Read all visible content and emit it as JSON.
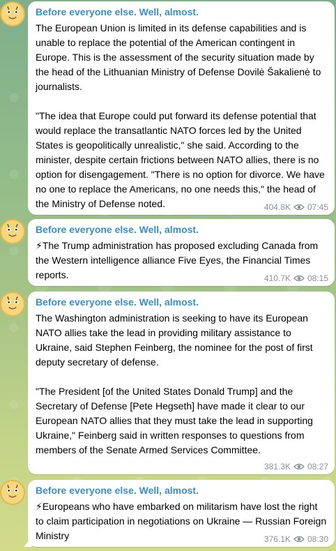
{
  "channel": {
    "sender_name": "Before everyone else. Well, almost."
  },
  "messages": [
    {
      "text": "The European Union is limited in its defense capabilities and is unable to replace the potential of the American contingent in Europe. This is the assessment of the security situation made by the head of the Lithuanian Ministry of Defense Dovilė Šakalienė to journalists.\n\n\"The idea that Europe could put forward its defense potential that would replace the transatlantic NATO forces led by the United States is geopolitically unrealistic,\" she said. According to the minister, despite certain frictions between NATO allies, there is no option for disengagement. \"There is no option for divorce. We have no one to replace the Americans, no one needs this,\" the head of the Ministry of Defense noted.",
      "views": "404.8K",
      "time": "07:45"
    },
    {
      "text": "⚡The Trump administration has proposed excluding Canada from the Western intelligence alliance Five Eyes, the Financial Times reports.",
      "views": "410.7K",
      "time": "08:15"
    },
    {
      "text": "The Washington administration is seeking to have its European NATO allies take the lead in providing military assistance to Ukraine, said Stephen Feinberg, the nominee for the post of first deputy secretary of defense.\n\n\"The President [of the United States Donald Trump] and the Secretary of Defense [Pete Hegseth] have made it clear to our European NATO allies that they must take the lead in supporting Ukraine,\" Feinberg said in written responses to questions from members of the Senate Armed Services Committee.",
      "views": "381.3K",
      "time": "08:27"
    },
    {
      "text": "⚡Europeans who have embarked on militarism have lost the right to claim participation in negotiations on Ukraine — Russian Foreign Ministry",
      "views": "376.1K",
      "time": "08:30"
    }
  ],
  "icons": {
    "avatar": "cartoon-bee-face-icon",
    "views": "eye-icon"
  },
  "colors": {
    "sender": "#3a8ec6",
    "meta": "#8a9399",
    "bubble": "#ffffff"
  }
}
